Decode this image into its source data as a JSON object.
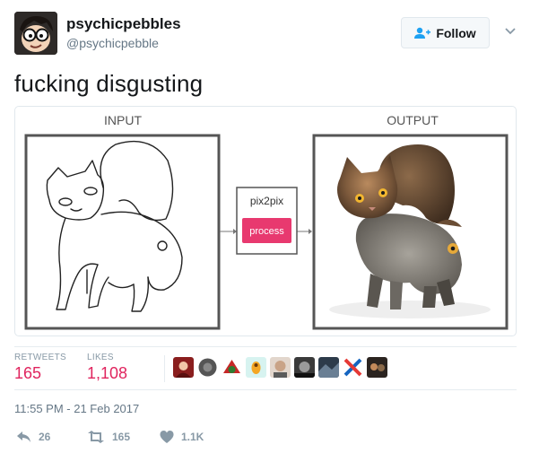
{
  "user": {
    "display_name": "psychicpebbles",
    "handle": "@psychicpebble"
  },
  "header": {
    "follow_label": "Follow"
  },
  "tweet": {
    "text": "fucking disgusting"
  },
  "media": {
    "input_label": "INPUT",
    "output_label": "OUTPUT",
    "model_label": "pix2pix",
    "process_label": "process"
  },
  "stats": {
    "retweets_label": "RETWEETS",
    "retweets_value": "165",
    "likes_label": "LIKES",
    "likes_value": "1,108",
    "likers_count": 9
  },
  "timestamp": "11:55 PM - 21 Feb 2017",
  "actions": {
    "reply_count": "26",
    "retweet_count": "165",
    "like_count": "1.1K"
  },
  "colors": {
    "accent_pink": "#e0245e",
    "process_button": "#e8396f",
    "follow_blue": "#1da1f2",
    "muted": "#8899a6"
  }
}
